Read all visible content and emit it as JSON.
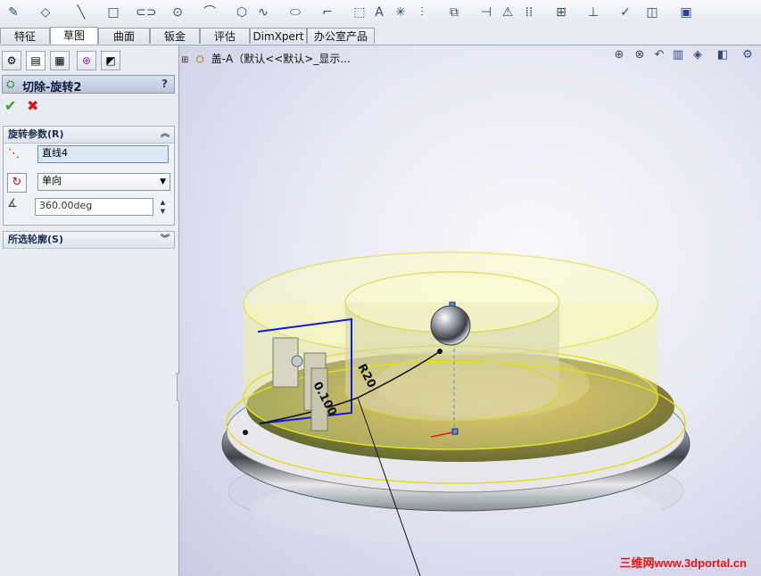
{
  "toolbar": {
    "icons": [
      "sketch-icon",
      "smart-dimension-icon",
      "line-icon",
      "rectangle-icon",
      "slot-icon",
      "circle-icon",
      "arc-icon",
      "polygon-icon",
      "spline-icon",
      "ellipse-icon",
      "fillet-icon",
      "plane-icon",
      "text-icon",
      "point-icon",
      "mirror-icon",
      "offset-icon",
      "trim-icon",
      "convert-icon",
      "pattern-icon",
      "move-icon",
      "relations-icon",
      "repair-icon",
      "rapid-sketch-icon",
      "instant3d-icon"
    ]
  },
  "tabs": [
    "特征",
    "草图",
    "曲面",
    "钣金",
    "评估",
    "DimXpert",
    "办公室产品"
  ],
  "active_tab": "草图",
  "feature_tree_root": "盖-A（默认<<默认>_显示...",
  "property_manager": {
    "title": "切除-旋转2",
    "help": "?",
    "ok_icon": "check-icon",
    "cancel_icon": "close-icon",
    "rotation_params": {
      "header": "旋转参数(R)",
      "axis_value": "直线4",
      "direction_value": "单向",
      "angle_value": "360.00deg"
    },
    "selected_contours": {
      "header": "所选轮廓(S)"
    }
  },
  "viewport": {
    "dimension_1": "0.100",
    "dimension_2": "R20",
    "watermark": "三维网www.3dportal.cn"
  }
}
